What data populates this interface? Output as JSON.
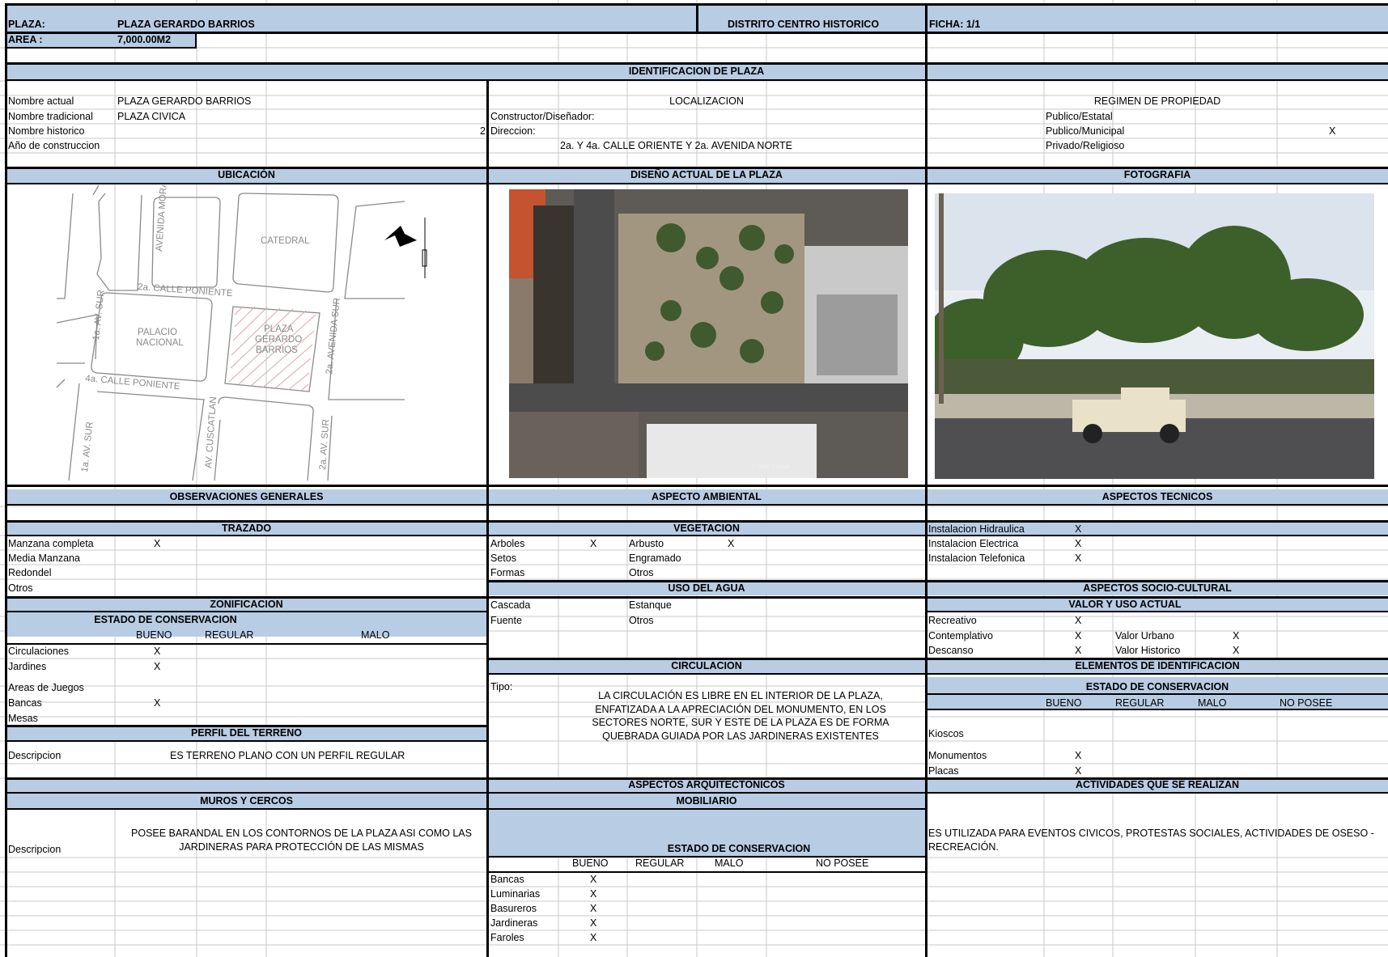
{
  "header": {
    "plaza_label": "PLAZA:",
    "plaza_name": "PLAZA GERARDO BARRIOS",
    "district": "DISTRITO CENTRO HISTORICO",
    "ficha": "FICHA: 1/1",
    "area_label": "AREA :",
    "area_value": "7,000.00M2"
  },
  "identificacion": {
    "title": "IDENTIFICACION DE  PLAZA",
    "rows": [
      {
        "label": "Nombre actual",
        "value": "PLAZA GERARDO BARRIOS"
      },
      {
        "label": "Nombre tradicional",
        "value": "PLAZA CIVICA"
      },
      {
        "label": "Nombre historico",
        "value": "2"
      },
      {
        "label": "Año de construccion",
        "value": ""
      }
    ],
    "localizacion_title": "LOCALIZACION",
    "constructor_label": "Constructor/Diseñador:",
    "direccion_label": "Direccion:",
    "direccion_value": "2a. Y 4a.  CALLE ORIENTE Y  2a. AVENIDA NORTE",
    "regimen_title": "REGIMEN DE PROPIEDAD",
    "regimen": [
      {
        "label": "Publico/Estatal",
        "mark": ""
      },
      {
        "label": "Publico/Municipal",
        "mark": "X"
      },
      {
        "label": "Privado/Religioso",
        "mark": ""
      }
    ]
  },
  "sections": {
    "ubicacion": "UBICACIÓN",
    "diseno": "DISEÑO ACTUAL DE LA PLAZA",
    "fotografia": "FOTOGRAFIA"
  },
  "map": {
    "morazan": "AVENIDA  MORAZAN",
    "catedral": "CATEDRAL",
    "calle_poniente_2": "2a.  CALLE  PONIENTE",
    "palacio": [
      "PALACIO",
      "NACIONAL"
    ],
    "plaza": [
      "PLAZA",
      "GERARDO",
      "BARRIOS"
    ],
    "av_sur_2": "2a.  AVENIDA  SUR",
    "av_sur_1_top": "1a.  AV.  SUR",
    "calle_poniente_4": "4a.  CALLE  PONIENTE",
    "av_sur_1_bottom": "1a.  AV.  SUR",
    "cuscatlan": "AV.  CUSCATLAN",
    "av_sur_2_bottom": "2a.  AV.  SUR",
    "north": "N"
  },
  "aerial_caption": "© 2010 Google",
  "left": {
    "observaciones_title": "OBSERVACIONES GENERALES",
    "trazado_title": "TRAZADO",
    "trazado": [
      {
        "label": "Manzana completa",
        "mark": "X"
      },
      {
        "label": "Media Manzana",
        "mark": ""
      },
      {
        "label": "Redondel",
        "mark": ""
      },
      {
        "label": "Otros",
        "mark": ""
      }
    ],
    "zonificacion_title": "ZONIFICACION",
    "estado_title": "ESTADO DE CONSERVACION",
    "estado_cols": [
      "BUENO",
      "REGULAR",
      "MALO"
    ],
    "zonas": [
      {
        "label": "Circulaciones",
        "mark": "X"
      },
      {
        "label": "Jardines",
        "mark": "X"
      },
      {
        "label": "Areas de Juegos",
        "mark": ""
      },
      {
        "label": "Bancas",
        "mark": "X"
      },
      {
        "label": "Mesas",
        "mark": ""
      }
    ],
    "perfil_title": "PERFIL DEL TERRENO",
    "perfil_label": "Descripcion",
    "perfil_value": "ES  TERRENO PLANO CON UN PERFIL REGULAR",
    "muros_title": "MUROS Y CERCOS",
    "muros_label": "Descripcion",
    "muros_value": "POSEE BARANDAL  EN LOS CONTORNOS DE LA PLAZA ASI COMO LAS JARDINERAS PARA PROTECCIÓN DE LAS MISMAS"
  },
  "middle": {
    "ambiental_title": "ASPECTO AMBIENTAL",
    "vegetacion_title": "VEGETACION",
    "vegetacion": [
      {
        "a": "Arboles",
        "am": "X",
        "b": "Arbusto",
        "bm": "X"
      },
      {
        "a": "Setos",
        "am": "",
        "b": "Engramado",
        "bm": ""
      },
      {
        "a": "Formas",
        "am": "",
        "b": "Otros",
        "bm": ""
      }
    ],
    "agua_title": "USO DEL AGUA",
    "agua": [
      {
        "a": "Cascada",
        "b": "Estanque"
      },
      {
        "a": "Fuente",
        "b": "Otros"
      }
    ],
    "circulacion_title": "CIRCULACION",
    "tipo_label": "Tipo:",
    "circulacion_text": "LA CIRCULACIÓN ES LIBRE EN EL INTERIOR DE LA PLAZA, ENFATIZADA A LA APRECIACIÓN DEL MONUMENTO, EN LOS SECTORES NORTE, SUR Y ESTE DE LA PLAZA ES DE FORMA QUEBRADA GUIADA POR  LAS JARDINERAS EXISTENTES",
    "arquitectonicos_title": "ASPECTOS ARQUITECTONICOS",
    "mobiliario_title": "MOBILIARIO",
    "estado_title": "ESTADO DE CONSERVACION",
    "estado_cols": [
      "BUENO",
      "REGULAR",
      "MALO",
      "NO POSEE"
    ],
    "mobiliario": [
      {
        "label": "Bancas",
        "mark": "X"
      },
      {
        "label": "Luminarias",
        "mark": "X"
      },
      {
        "label": "Basureros",
        "mark": "X"
      },
      {
        "label": "Jardineras",
        "mark": "X"
      },
      {
        "label": "Faroles",
        "mark": "X"
      }
    ]
  },
  "right": {
    "tecnicos_title": "ASPECTOS TECNICOS",
    "tecnicos": [
      {
        "label": "Instalacion Hidraulica",
        "mark": "X"
      },
      {
        "label": "Instalacion Electrica",
        "mark": "X"
      },
      {
        "label": "Instalacion Telefonica",
        "mark": "X"
      }
    ],
    "socio_title": "ASPECTOS SOCIO-CULTURAL",
    "valor_title": "VALOR   Y USO ACTUAL",
    "usos": [
      {
        "label": "Recreativo",
        "mark": "X",
        "v": "",
        "vm": ""
      },
      {
        "label": "Contemplativo",
        "mark": "X",
        "v": "Valor Urbano",
        "vm": "X"
      },
      {
        "label": "Descanso",
        "mark": "X",
        "v": "Valor Historico",
        "vm": "X"
      }
    ],
    "elementos_title": "ELEMENTOS DE IDENTIFICACION",
    "estado_title": "ESTADO DE CONSERVACION",
    "estado_cols": [
      "BUENO",
      "REGULAR",
      "MALO",
      "NO POSEE"
    ],
    "elementos": [
      {
        "label": "Kioscos",
        "mark": ""
      },
      {
        "label": "Monumentos",
        "mark": "X"
      },
      {
        "label": "Placas",
        "mark": "X"
      }
    ],
    "actividades_title": "ACTIVIDADES QUE SE REALIZAN",
    "actividades_text": "ES UTILIZADA PARA EVENTOS CIVICOS, PROTESTAS SOCIALES, ACTIVIDADES DE OSESO - RECREACIÓN."
  },
  "colors": {
    "header_fill": "#b8cce4",
    "grid_line": "#c0c0c0",
    "border": "#000000"
  }
}
